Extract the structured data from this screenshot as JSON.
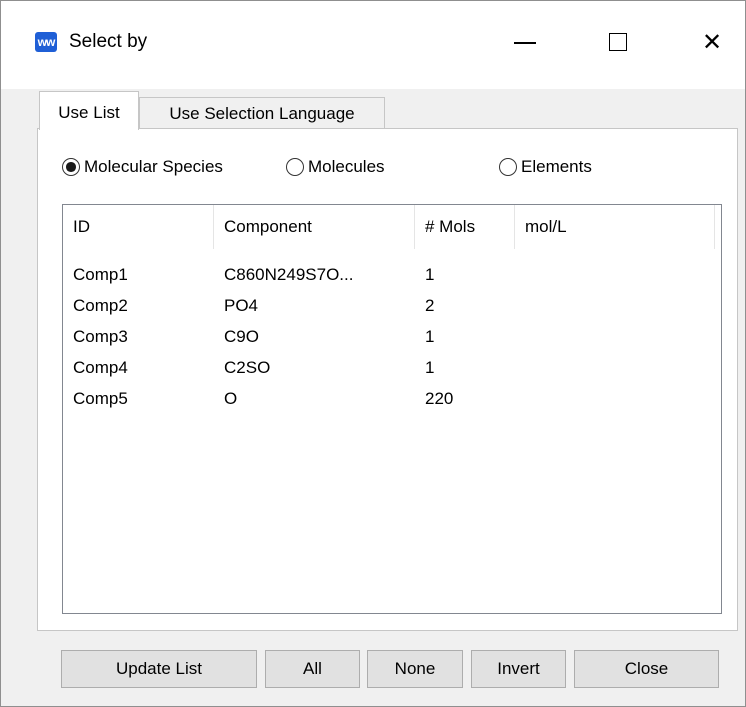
{
  "window": {
    "title": "Select by",
    "app_icon": "app-logo-icon",
    "controls": {
      "minimize": "minimize-icon",
      "maximize": "maximize-icon",
      "close": "✕"
    }
  },
  "tabs": [
    {
      "label": "Use List",
      "active": true
    },
    {
      "label": "Use Selection Language",
      "active": false
    }
  ],
  "radios": [
    {
      "label": "Molecular Species",
      "checked": true
    },
    {
      "label": "Molecules",
      "checked": false
    },
    {
      "label": "Elements",
      "checked": false
    }
  ],
  "table": {
    "columns": [
      "ID",
      "Component",
      "# Mols",
      "mol/L"
    ],
    "rows": [
      [
        "Comp1",
        "C860N249S7O...",
        "1",
        ""
      ],
      [
        "Comp2",
        "PO4",
        "2",
        ""
      ],
      [
        "Comp3",
        "C9O",
        "1",
        ""
      ],
      [
        "Comp4",
        "C2SO",
        "1",
        ""
      ],
      [
        "Comp5",
        "O",
        "220",
        ""
      ]
    ]
  },
  "buttons": {
    "update_list": "Update List",
    "all": "All",
    "none": "None",
    "invert": "Invert",
    "close": "Close"
  },
  "colors": {
    "accent": "#1f5fd6",
    "button_bg": "#e1e1e1",
    "window_bg": "#f0f0f0"
  }
}
